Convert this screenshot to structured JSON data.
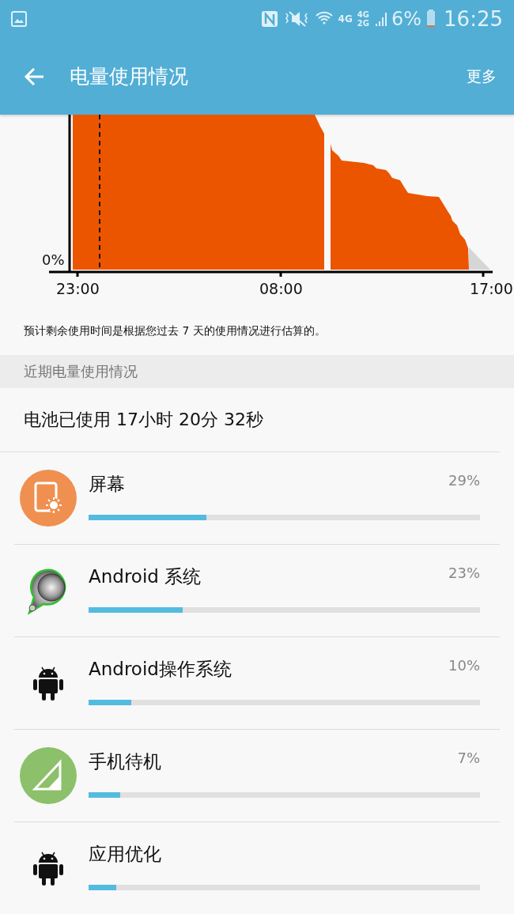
{
  "status_bar": {
    "battery": "6%",
    "time": "16:25",
    "network_1": "4G",
    "network_2": "4G",
    "network_3": "2G"
  },
  "app_bar": {
    "title": "电量使用情况",
    "more": "更多"
  },
  "chart": {
    "y_label": "0%",
    "x_labels": [
      "23:00",
      "08:00",
      "17:00"
    ]
  },
  "note": "预计剩余使用时间是根据您过去 7 天的使用情况进行估算的。",
  "section_header": "近期电量使用情况",
  "total_usage": "电池已使用 17小时 20分 32秒",
  "apps": [
    {
      "name": "屏幕",
      "percent": "29%",
      "level": 0.3,
      "kind": "screen"
    },
    {
      "name": "Android 系统",
      "percent": "23%",
      "level": 0.24,
      "kind": "system"
    },
    {
      "name": "Android操作系统",
      "percent": "10%",
      "level": 0.11,
      "kind": "android"
    },
    {
      "name": "手机待机",
      "percent": "7%",
      "level": 0.08,
      "kind": "standby"
    },
    {
      "name": "应用优化",
      "level": 0.07,
      "kind": "android"
    }
  ]
}
